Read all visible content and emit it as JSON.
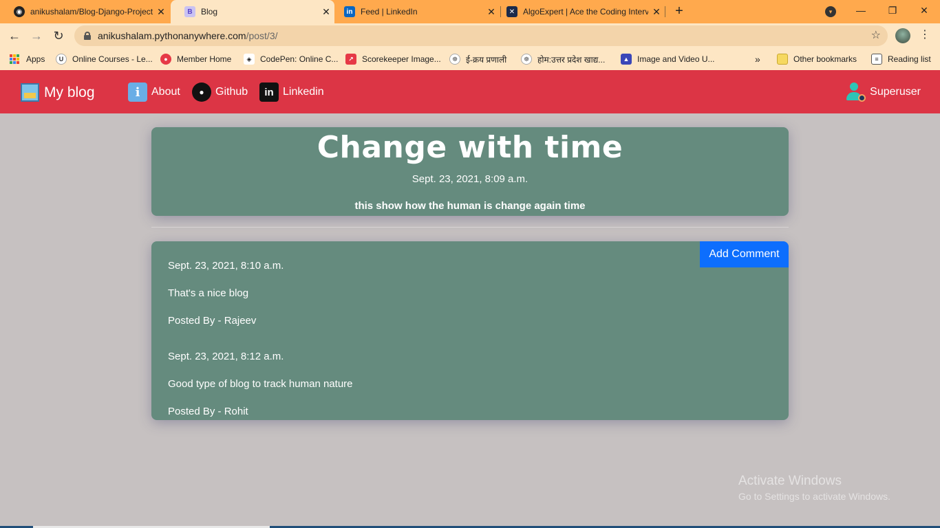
{
  "browser": {
    "tabs": [
      {
        "title": "anikushalam/Blog-Django-Project",
        "favicon": "github-icon"
      },
      {
        "title": "Blog",
        "favicon": "bootstrap-icon"
      },
      {
        "title": "Feed | LinkedIn",
        "favicon": "linkedin-icon"
      },
      {
        "title": "AlgoExpert | Ace the Coding Interviews",
        "favicon": "algoexpert-icon"
      }
    ],
    "active_tab_index": 1,
    "url_host": "anikushalam.pythonanywhere.com",
    "url_path": "/post/3/",
    "bookmarks": [
      {
        "label": "Apps",
        "icon": "apps-grid-icon"
      },
      {
        "label": "Online Courses - Le...",
        "icon": "udemy-icon"
      },
      {
        "label": "Member Home",
        "icon": "member-icon"
      },
      {
        "label": "CodePen: Online C...",
        "icon": "codepen-icon"
      },
      {
        "label": "Scorekeeper Image...",
        "icon": "scorekeeper-icon"
      },
      {
        "label": "ई-क्रय प्रणाली",
        "icon": "emblem-icon"
      },
      {
        "label": "होम:उत्तर प्रदेश खाद्य...",
        "icon": "emblem-icon"
      },
      {
        "label": "Image and Video U...",
        "icon": "image-upload-icon"
      }
    ],
    "bookmarks_overflow": "»",
    "other_bookmarks": "Other bookmarks",
    "reading_list": "Reading list"
  },
  "navbar": {
    "brand": "My blog",
    "links": [
      {
        "label": "About",
        "icon": "info-icon"
      },
      {
        "label": "Github",
        "icon": "github-icon"
      },
      {
        "label": "Linkedin",
        "icon": "linkedin-icon"
      }
    ],
    "user": "Superuser",
    "color": "#dc3545"
  },
  "post": {
    "title": "Change with time",
    "date": "Sept. 23, 2021, 8:09 a.m.",
    "description": "this show how the human is change again time"
  },
  "comments": {
    "add_label": "Add Comment",
    "items": [
      {
        "date": "Sept. 23, 2021, 8:10 a.m.",
        "text": "That's a nice blog",
        "author": "Posted By - Rajeev"
      },
      {
        "date": "Sept. 23, 2021, 8:12 a.m.",
        "text": "Good type of blog to track human nature",
        "author": "Posted By - Rohit"
      }
    ]
  },
  "watermark": {
    "line1": "Activate Windows",
    "line2": "Go to Settings to activate Windows."
  }
}
